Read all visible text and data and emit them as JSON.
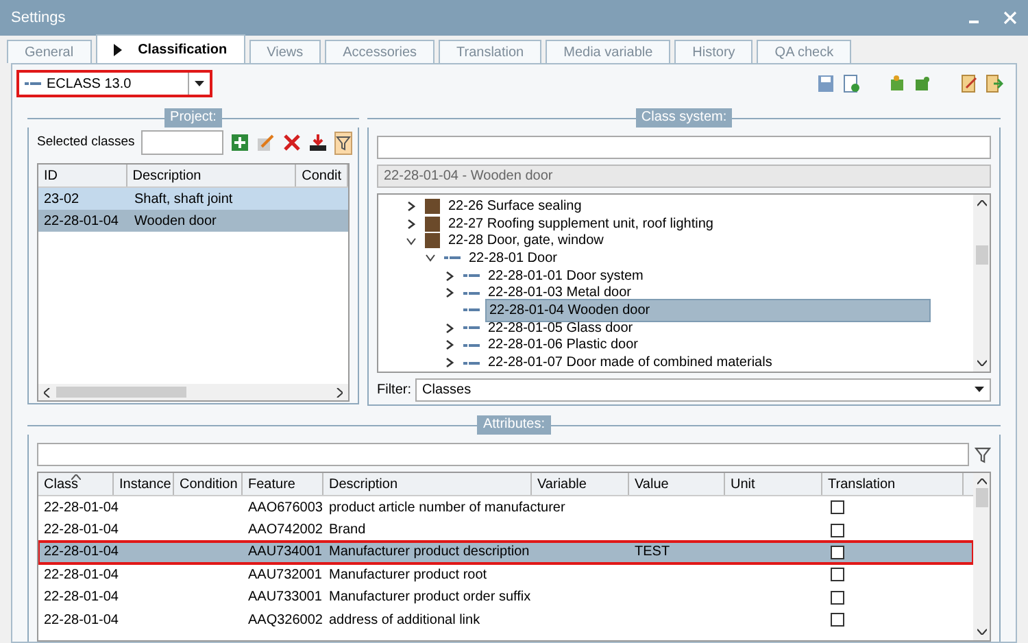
{
  "window": {
    "title": "Settings"
  },
  "tabs": [
    {
      "label": "General",
      "selected": false
    },
    {
      "label": "Classification",
      "selected": true
    },
    {
      "label": "Views",
      "selected": false
    },
    {
      "label": "Accessories",
      "selected": false
    },
    {
      "label": "Translation",
      "selected": false
    },
    {
      "label": "Media variable",
      "selected": false
    },
    {
      "label": "History",
      "selected": false
    },
    {
      "label": "QA check",
      "selected": false
    }
  ],
  "class_system_select": {
    "value": "ECLASS 13.0"
  },
  "project": {
    "legend": "Project:",
    "selected_classes_label": "Selected classes",
    "filter_active": true,
    "columns": [
      "ID",
      "Description",
      "Condit"
    ],
    "rows": [
      {
        "id": "23-02",
        "description": "Shaft, shaft joint",
        "selected": false,
        "highlighted": true
      },
      {
        "id": "22-28-01-04",
        "description": "Wooden door",
        "selected": true,
        "highlighted": false
      }
    ]
  },
  "class_system": {
    "legend": "Class system:",
    "path": "22-28-01-04 - Wooden door",
    "tree": [
      {
        "label": "22-26 Surface sealing",
        "kind": "image",
        "expandable": true,
        "expanded": false,
        "selected": false
      },
      {
        "label": "22-27 Roofing supplement unit, roof lighting",
        "kind": "image",
        "expandable": true,
        "expanded": false,
        "selected": false
      },
      {
        "label": "22-28 Door, gate, window",
        "kind": "image",
        "expandable": true,
        "expanded": true,
        "selected": false,
        "children": [
          {
            "label": "22-28-01 Door",
            "kind": "class",
            "expandable": true,
            "expanded": true,
            "selected": false,
            "children": [
              {
                "label": "22-28-01-01 Door system",
                "kind": "class",
                "expandable": true,
                "expanded": false,
                "selected": false
              },
              {
                "label": "22-28-01-03 Metal door",
                "kind": "class",
                "expandable": true,
                "expanded": false,
                "selected": false
              },
              {
                "label": "22-28-01-04 Wooden door",
                "kind": "class",
                "expandable": false,
                "selected": true
              },
              {
                "label": "22-28-01-05 Glass door",
                "kind": "class",
                "expandable": true,
                "expanded": false,
                "selected": false
              },
              {
                "label": "22-28-01-06 Plastic door",
                "kind": "class",
                "expandable": true,
                "expanded": false,
                "selected": false
              },
              {
                "label": "22-28-01-07 Door made of combined materials",
                "kind": "class",
                "expandable": true,
                "expanded": false,
                "selected": false
              }
            ]
          }
        ]
      }
    ],
    "filter_label": "Filter:",
    "filter_value": "Classes"
  },
  "attributes": {
    "legend": "Attributes:",
    "columns": [
      "Class",
      "Instance",
      "Condition",
      "Feature",
      "Description",
      "Variable",
      "Value",
      "Unit",
      "Translation"
    ],
    "rows": [
      {
        "class": "22-28-01-04",
        "feature": "AAO676003",
        "description": "product article number of manufacturer",
        "translation": false,
        "selected": false
      },
      {
        "class": "22-28-01-04",
        "feature": "AAO742002",
        "description": "Brand",
        "translation": false,
        "selected": false
      },
      {
        "class": "22-28-01-04",
        "feature": "AAU734001",
        "description": "Manufacturer product description",
        "value": "TEST",
        "translation": false,
        "selected": true
      },
      {
        "class": "22-28-01-04",
        "feature": "AAU732001",
        "description": "Manufacturer product root",
        "translation": false,
        "selected": false
      },
      {
        "class": "22-28-01-04",
        "feature": "AAU733001",
        "description": "Manufacturer product order suffix",
        "translation": false,
        "selected": false
      },
      {
        "class": "22-28-01-04",
        "feature": "AAQ326002",
        "description": "address of additional link",
        "translation": false,
        "selected": false
      }
    ]
  }
}
